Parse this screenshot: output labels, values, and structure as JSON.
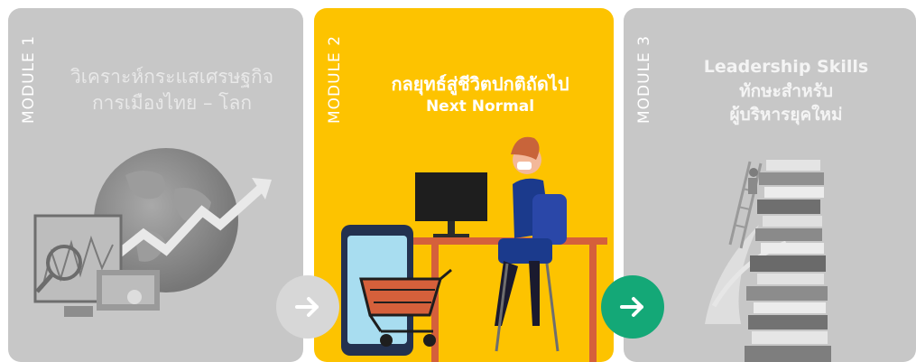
{
  "modules": [
    {
      "tag": "MODULE 1",
      "title_line1": "วิเคราะห์กระแสเศรษฐกิจ",
      "title_line2": "การเมืองไทย – โลก",
      "illustration": "globe-chart-illustration"
    },
    {
      "tag": "MODULE 2",
      "title_line1": "กลยุทธ์สู่ชีวิตปกติถัดไป",
      "title_line2": "Next Normal",
      "illustration": "remote-work-shopping-illustration"
    },
    {
      "tag": "MODULE 3",
      "title_line1": "Leadership Skills",
      "title_line2": "ทักษะสำหรับ",
      "title_line3": "ผู้บริหารยุคใหม่",
      "illustration": "books-ladder-illustration"
    }
  ],
  "arrows": [
    {
      "icon": "arrow-right-icon",
      "color": "#d7d7d7"
    },
    {
      "icon": "arrow-right-icon",
      "color": "#14a877"
    }
  ],
  "colors": {
    "card_gray": "#c7c7c7",
    "card_yellow": "#fdc300",
    "accent_green": "#14a877"
  }
}
